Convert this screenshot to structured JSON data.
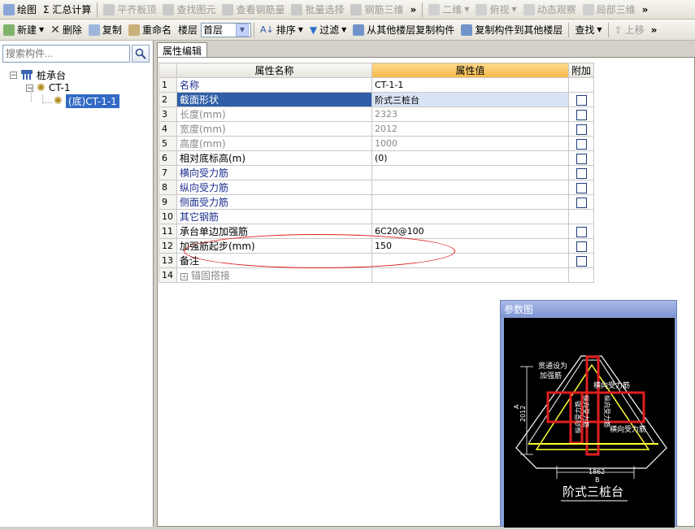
{
  "toolbar1": {
    "items": [
      {
        "label": "绘图",
        "icon": "pencil-icon",
        "enabled": true
      },
      {
        "label": "Σ 汇总计算",
        "icon": "sigma-icon",
        "enabled": true
      },
      {
        "label": "平齐板顶",
        "icon": "align-icon",
        "enabled": false
      },
      {
        "label": "查找图元",
        "icon": "binoculars-icon",
        "enabled": false
      },
      {
        "label": "查看钢筋量",
        "icon": "rebar-icon",
        "enabled": false
      },
      {
        "label": "批量选择",
        "icon": "batch-icon",
        "enabled": false
      },
      {
        "label": "钢筋三维",
        "icon": "rebar3d-icon",
        "enabled": false
      },
      {
        "label": "二维",
        "icon": "view2d-icon",
        "enabled": false
      },
      {
        "label": "俯视",
        "icon": "topview-icon",
        "enabled": false
      },
      {
        "label": "动态观察",
        "icon": "orbit-icon",
        "enabled": false
      },
      {
        "label": "局部三维",
        "icon": "local3d-icon",
        "enabled": false
      }
    ],
    "overflow": "»"
  },
  "toolbar2": {
    "new_label": "新建",
    "delete_label": "删除",
    "copy_label": "复制",
    "rename_label": "重命名",
    "floor_label": "楼层",
    "floor_value": "首层",
    "sort_label": "排序",
    "filter_label": "过滤",
    "copy_from_label": "从其他楼层复制构件",
    "copy_to_label": "复制构件到其他楼层",
    "find_label": "查找",
    "move_up_label": "上移",
    "overflow": "»"
  },
  "sidebar": {
    "search_placeholder": "搜索构件...",
    "tree": {
      "root": "桩承台",
      "child": "CT-1",
      "leaf": "(底)CT-1-1"
    }
  },
  "tab": {
    "label": "属性编辑"
  },
  "grid": {
    "headers": {
      "name": "属性名称",
      "value": "属性值",
      "extra": "附加"
    },
    "rows": [
      {
        "num": "1",
        "name": "名称",
        "value": "CT-1-1",
        "style": "blue",
        "check": false
      },
      {
        "num": "2",
        "name": "截面形状",
        "value": "阶式三桩台",
        "style": "selected",
        "check": true
      },
      {
        "num": "3",
        "name": "长度(mm)",
        "value": "2323",
        "style": "gray",
        "check": true
      },
      {
        "num": "4",
        "name": "宽度(mm)",
        "value": "2012",
        "style": "gray",
        "check": true
      },
      {
        "num": "5",
        "name": "高度(mm)",
        "value": "1000",
        "style": "gray",
        "check": true
      },
      {
        "num": "6",
        "name": "相对底标高(m)",
        "value": "(0)",
        "style": "normal",
        "check": true
      },
      {
        "num": "7",
        "name": "横向受力筋",
        "value": "",
        "style": "blue",
        "check": true
      },
      {
        "num": "8",
        "name": "纵向受力筋",
        "value": "",
        "style": "blue",
        "check": true
      },
      {
        "num": "9",
        "name": "侧面受力筋",
        "value": "",
        "style": "blue",
        "check": true
      },
      {
        "num": "10",
        "name": "其它钢筋",
        "value": "",
        "style": "blue",
        "check": false
      },
      {
        "num": "11",
        "name": "承台单边加强筋",
        "value": "6C20@100",
        "style": "normal",
        "check": true
      },
      {
        "num": "12",
        "name": "加强筋起步(mm)",
        "value": "150",
        "style": "normal",
        "check": true
      },
      {
        "num": "13",
        "name": "备注",
        "value": "",
        "style": "normal",
        "check": true
      },
      {
        "num": "14",
        "name": "锚固搭接",
        "value": "",
        "style": "group",
        "check": false
      }
    ]
  },
  "param_panel": {
    "title": "参数图",
    "labels": {
      "note_line1": "贯通设为",
      "note_line2": "加强筋",
      "h_rebar": "横向受力筋",
      "v_rebar1": "纵向受力筋",
      "v_rebar2": "纵向受力筋",
      "v_rebar3": "纵向受力筋",
      "h_rebar_bottom": "横向受力筋",
      "dim_a_value": "2012",
      "dim_a_letter": "A",
      "dim_b_value": "1862",
      "dim_b_letter": "B",
      "caption": "阶式三桩台"
    }
  },
  "colors": {
    "selected_row": "#2f5ea7",
    "header_highlight": "#f5b94a",
    "annotation_red": "#e01e1e",
    "drawing_white": "#ffffff",
    "drawing_red": "#e01e1e",
    "drawing_yellow": "#ffff33",
    "panel_title": "#8aa0d8"
  }
}
